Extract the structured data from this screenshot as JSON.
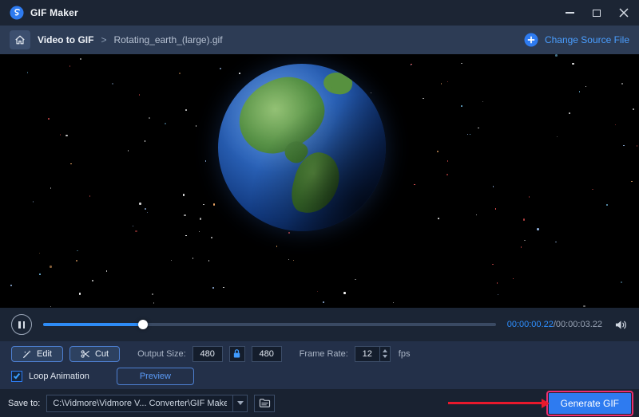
{
  "titlebar": {
    "title": "GIF Maker"
  },
  "breadcrumb": {
    "section": "Video to GIF",
    "separator": ">",
    "filename": "Rotating_earth_(large).gif",
    "change_source_label": "Change Source File"
  },
  "player": {
    "current_time": "00:00:00.22",
    "total_time": "/00:00:03.22",
    "progress_percent": 22
  },
  "toolbar": {
    "edit_label": "Edit",
    "cut_label": "Cut",
    "output_size_label": "Output Size:",
    "output_width": "480",
    "output_height": "480",
    "frame_rate_label": "Frame Rate:",
    "frame_rate_value": "12",
    "fps_label": "fps"
  },
  "options": {
    "loop_label": "Loop Animation",
    "loop_checked": true,
    "preview_label": "Preview"
  },
  "footer": {
    "save_to_label": "Save to:",
    "save_path": "C:\\Vidmore\\Vidmore V... Converter\\GIF Maker",
    "generate_label": "Generate GIF"
  },
  "colors": {
    "accent_blue": "#2e7bf0",
    "time_blue": "#2e8fff",
    "annotation_red": "#e8192c"
  }
}
